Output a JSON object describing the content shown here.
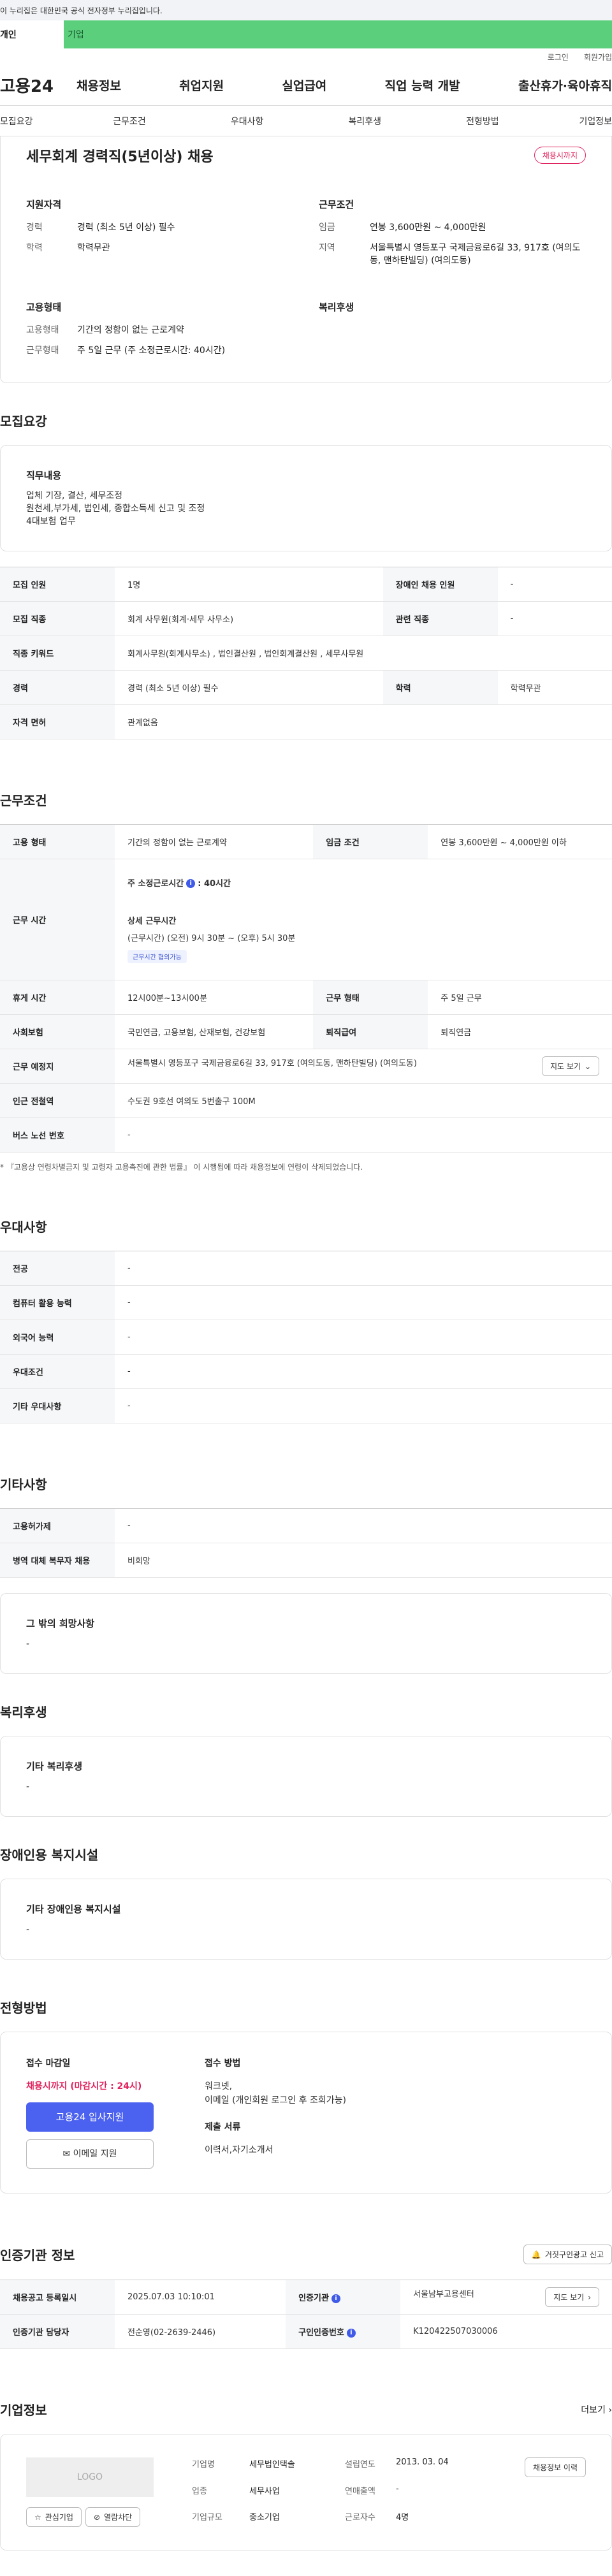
{
  "gov_bar": {
    "text": "이 누리집은 대한민국 공식 전자정부 누리집입니다."
  },
  "user_tabs": [
    "개인",
    "기업"
  ],
  "util": [
    "로그인",
    "회원가입"
  ],
  "logo": "고용24",
  "gnb": [
    "채용정보",
    "취업지원",
    "실업급여",
    "직업 능력 개발",
    "출산휴가·육아휴직"
  ],
  "sub_tabs": [
    "모집요강",
    "근무조건",
    "우대사항",
    "복리후생",
    "전형방법",
    "기업정보"
  ],
  "summary": {
    "title": "세무회계 경력직(5년이상) 채용",
    "badge": "채용시까지",
    "qualification_h": "지원자격",
    "career_k": "경력",
    "career_v": "경력 (최소 5년 이상) 필수",
    "edu_k": "학력",
    "edu_v": "학력무관",
    "employment_h": "고용형태",
    "emp_type_k": "고용형태",
    "emp_type_v": "기간의 정함이 없는 근로계약",
    "work_type_k": "근무형태",
    "work_type_v": "주 5일 근무 (주 소정근로시간: 40시간)",
    "conditions_h": "근무조건",
    "wage_k": "임금",
    "wage_v": "연봉 3,600만원 ~ 4,000만원",
    "region_k": "지역",
    "region_v": "서울특별시 영등포구 국제금융로6길 33, 917호 (여의도동, 맨하탄빌딩) (여의도동)",
    "welfare_h": "복리후생"
  },
  "recruit": {
    "title": "모집요강",
    "job_h": "직무내용",
    "job_t": "업체 기장, 결산, 세무조정\n원천세,부가세, 법인세, 종합소득세 신고 및 조정\n4대보험 업무",
    "rows": [
      [
        "모집 인원",
        "1명",
        "장애인 채용 인원",
        "-"
      ],
      [
        "모집 직종",
        "회계 사무원(회계·세무 사무소)",
        "관련 직종",
        "-"
      ],
      [
        "직종 키워드",
        "회계사무원(회계사무소) , 법인결산원 , 법인회계결산원 , 세무사무원"
      ],
      [
        "경력",
        "경력 (최소 5년 이상) 필수",
        "학력",
        "학력무관"
      ],
      [
        "자격 면허",
        "관계없음"
      ]
    ]
  },
  "work": {
    "title": "근무조건",
    "emp_k": "고용 형태",
    "emp_v": "기간의 정함이 없는 근로계약",
    "wage_k": "임금 조건",
    "wage_v": "연봉 3,600만원 ~ 4,000만원 이하",
    "time_k": "근무 시간",
    "time_h1": "주 소정근로시간",
    "time_h1_v": ": 40시간",
    "time_h2": "상세 근무시간",
    "time_detail": "(근무시간) (오전) 9시 30분 ~ (오후) 5시 30분",
    "time_chip": "근무시간 협의가능",
    "rest_k": "휴게 시간",
    "rest_v": "12시00분~13시00분",
    "shape_k": "근무 형태",
    "shape_v": "주 5일 근무",
    "ins_k": "사회보험",
    "ins_v": "국민연금, 고용보험, 산재보험, 건강보험",
    "ret_k": "퇴직급여",
    "ret_v": "퇴직연금",
    "place_k": "근무 예정지",
    "place_v": "서울특별시 영등포구 국제금융로6길 33, 917호 (여의도동, 맨하탄빌딩) (여의도동)",
    "map_btn": "지도 보기",
    "subway_k": "인근 전철역",
    "subway_v": "수도권 9호선 여의도 5번출구 100M",
    "bus_k": "버스 노선 번호",
    "bus_v": "-",
    "note": "* 『고용상 연령차별금지 및 고령자 고용촉진에 관한 법률』 이 시행됨에 따라 채용정보에 연령이 삭제되었습니다."
  },
  "pref": {
    "title": "우대사항",
    "rows": [
      [
        "전공",
        "-"
      ],
      [
        "컴퓨터 활용 능력",
        "-"
      ],
      [
        "외국어 능력",
        "-"
      ],
      [
        "우대조건",
        "-"
      ],
      [
        "기타 우대사항",
        "-"
      ]
    ]
  },
  "etc": {
    "title": "기타사항",
    "rows": [
      [
        "고용허가제",
        "-"
      ],
      [
        "병역 대체 복무자 채용",
        "비희망"
      ]
    ],
    "other_h": "그 밖의 희망사항",
    "other_t": "-"
  },
  "welfare": {
    "title": "복리후생",
    "h": "기타 복리후생",
    "t": "-"
  },
  "disab": {
    "title": "장애인용 복지시설",
    "h": "기타 장애인용 복지시설",
    "t": "-"
  },
  "process": {
    "title": "전형방법",
    "deadline_h": "접수 마감일",
    "deadline_v": "채용시까지 (마감시간 : 24시)",
    "apply_btn": "고용24 입사지원",
    "email_btn": "이메일 지원",
    "method_h": "접수 방법",
    "method_t": "워크넷,\n이메일 (개인회원 로그인 후 조회가능)",
    "docs_h": "제출 서류",
    "docs_t": "이력서,자기소개서"
  },
  "cert": {
    "title": "인증기관 정보",
    "report_btn": "거짓구인광고 신고",
    "reg_k": "채용공고 등록일시",
    "reg_v": "2025.07.03 10:10:01",
    "org_k": "인증기관",
    "org_v": "서울남부고용센터",
    "org_btn": "지도 보기",
    "mgr_k": "인증기관 담당자",
    "mgr_v": "전순영(02-2639-2446)",
    "no_k": "구인인증번호",
    "no_v": "K120422507030006"
  },
  "company": {
    "title": "기업정보",
    "more": "더보기",
    "logo": "LOGO",
    "fav_btn": "관심기업",
    "block_btn": "열람차단",
    "history_btn": "채용정보 이력",
    "name_k": "기업명",
    "name_v": "세무법인택솔",
    "year_k": "설립연도",
    "year_v": "2013. 03. 04",
    "ind_k": "업종",
    "ind_v": "세무사업",
    "sales_k": "연매출액",
    "sales_v": "-",
    "size_k": "기업규모",
    "size_v": "중소기업",
    "staff_k": "근로자수",
    "staff_v": "4명"
  }
}
